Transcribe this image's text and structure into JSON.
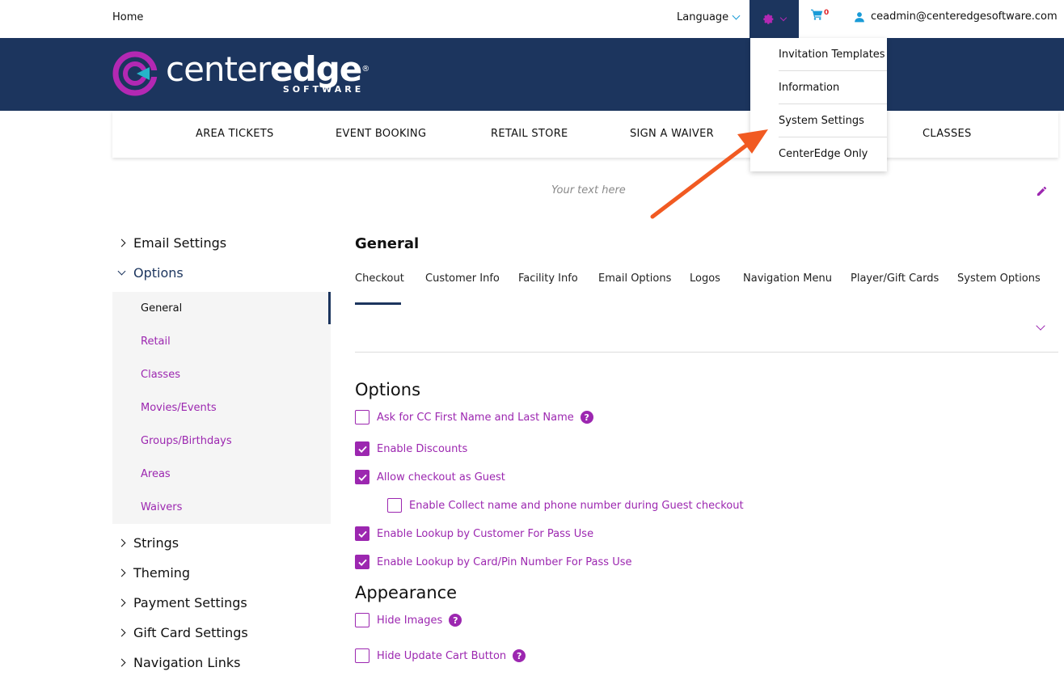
{
  "topbar": {
    "home": "Home",
    "language": "Language",
    "cart_count": "0",
    "user_email": "ceadmin@centeredgesoftware.com"
  },
  "logo": {
    "word_light": "center",
    "word_bold": "edge",
    "reg": "®",
    "subtitle": "SOFTWARE"
  },
  "nav": {
    "items": [
      "AREA TICKETS",
      "EVENT BOOKING",
      "RETAIL STORE",
      "SIGN A WAIVER",
      "CLASSES"
    ]
  },
  "settings_menu": {
    "items": [
      "Invitation Templates",
      "Information",
      "System Settings",
      "CenterEdge Only"
    ]
  },
  "banner_text": {
    "placeholder": "Your text here"
  },
  "sidebar": {
    "groups": [
      "Email Settings",
      "Options",
      "Strings",
      "Theming",
      "Payment Settings",
      "Gift Card Settings",
      "Navigation Links"
    ],
    "options_items": [
      "General",
      "Retail",
      "Classes",
      "Movies/Events",
      "Groups/Birthdays",
      "Areas",
      "Waivers"
    ]
  },
  "main": {
    "title": "General",
    "tabs": [
      "Checkout",
      "Customer Info",
      "Facility Info",
      "Email Options",
      "Logos",
      "Navigation Menu",
      "Player/Gift Cards",
      "System Options"
    ],
    "options_heading": "Options",
    "options": [
      {
        "label": "Ask for CC First Name and Last Name",
        "checked": false
      },
      {
        "label": "Enable Discounts",
        "checked": true
      },
      {
        "label": "Allow checkout as Guest",
        "checked": true
      },
      {
        "label": "Enable Collect name and phone number during Guest checkout",
        "checked": false
      },
      {
        "label": "Enable Lookup by Customer For Pass Use",
        "checked": true
      },
      {
        "label": "Enable Lookup by Card/Pin Number For Pass Use",
        "checked": true
      }
    ],
    "appearance_heading": "Appearance",
    "appearance": [
      {
        "label": "Hide Images",
        "checked": false
      },
      {
        "label": "Hide Update Cart Button",
        "checked": false
      }
    ],
    "help_glyph": "?"
  },
  "colors": {
    "navy": "#1c355e",
    "accent_purple": "#9c27b0",
    "arrow_orange": "#f15a22",
    "cart_red": "#e0252b"
  },
  "icons": [
    "gear-icon",
    "cart-icon",
    "user-icon",
    "pencil-icon",
    "chevron-down-icon",
    "help-icon",
    "check-icon"
  ]
}
